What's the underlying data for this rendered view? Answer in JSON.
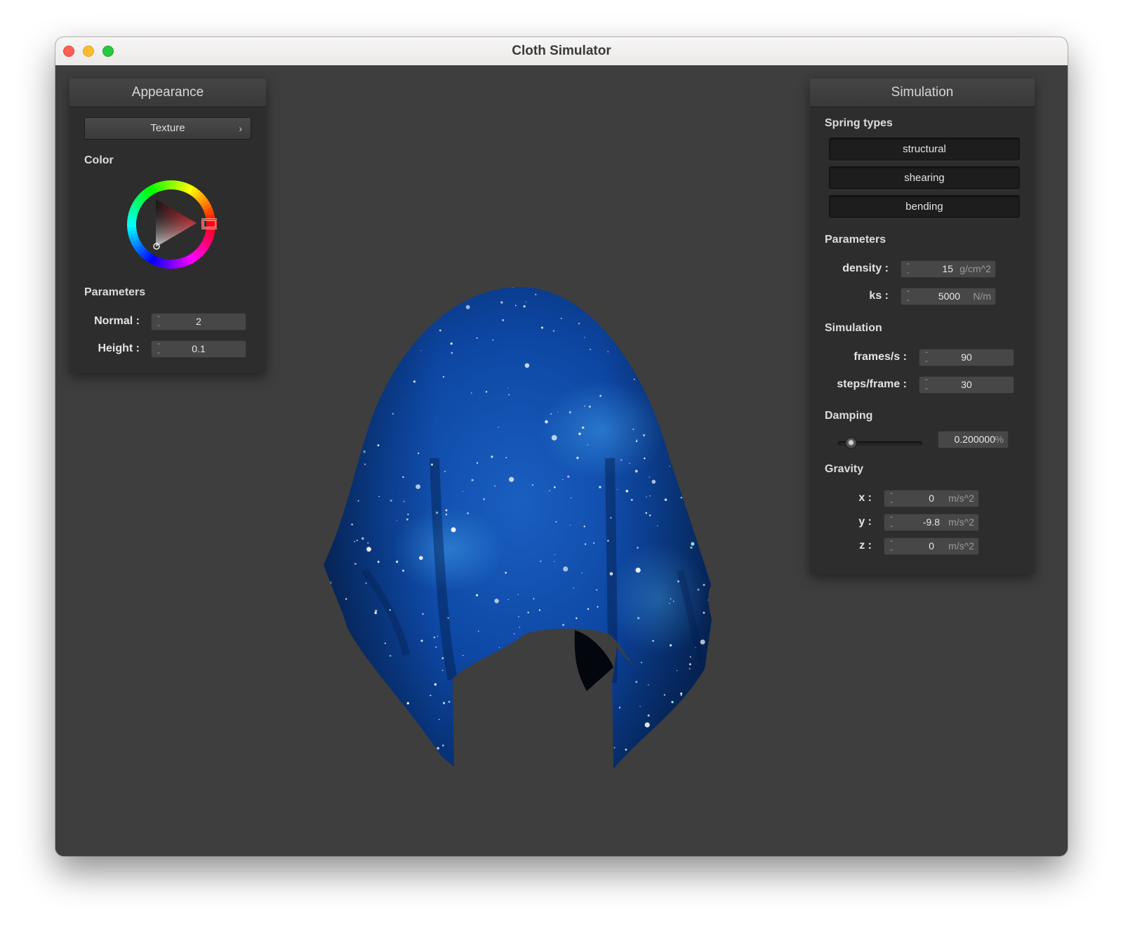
{
  "window": {
    "title": "Cloth Simulator"
  },
  "appearance": {
    "header": "Appearance",
    "texture_button": "Texture",
    "texture_chevron": "›",
    "color_label": "Color",
    "parameters_label": "Parameters",
    "normal_label": "Normal :",
    "normal_value": "2",
    "height_label": "Height :",
    "height_value": "0.1",
    "selected_color": "#e0101a"
  },
  "simulation": {
    "header": "Simulation",
    "spring_types_label": "Spring types",
    "spring_buttons": [
      "structural",
      "shearing",
      "bending"
    ],
    "parameters_label": "Parameters",
    "density_label": "density :",
    "density_value": "15",
    "density_unit": "g/cm^2",
    "ks_label": "ks :",
    "ks_value": "5000",
    "ks_unit": "N/m",
    "simulation_label": "Simulation",
    "fps_label": "frames/s :",
    "fps_value": "90",
    "steps_label": "steps/frame :",
    "steps_value": "30",
    "damping_label": "Damping",
    "damping_value": "0.200000",
    "damping_unit": "%",
    "damping_level": 0.2,
    "gravity_label": "Gravity",
    "gx_label": "x :",
    "gx_value": "0",
    "gy_label": "y :",
    "gy_value": "-9.8",
    "gz_label": "z :",
    "gz_value": "0",
    "gravity_unit": "m/s^2"
  },
  "colors": {
    "viewport_bg": "#3e3e3e",
    "panel_bg": "#2d2d2d",
    "cloth_base": "#0a3f94"
  }
}
